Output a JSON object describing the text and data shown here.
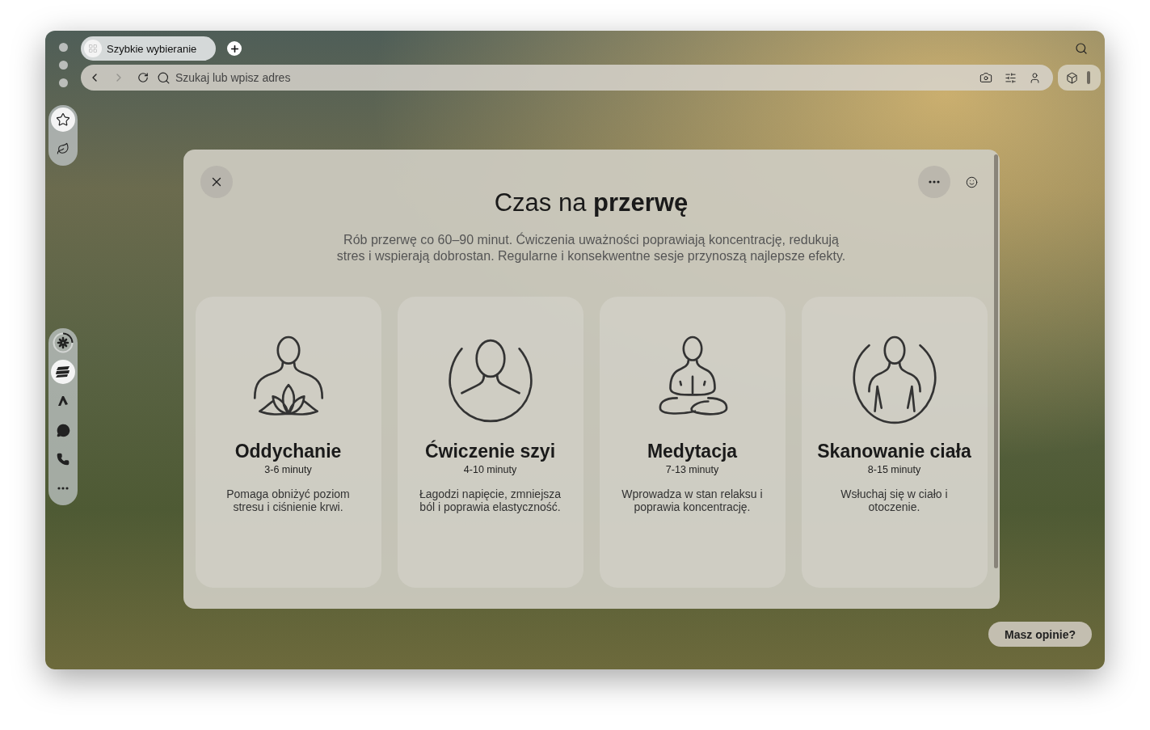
{
  "tabs": [
    {
      "label": "Szybkie wybieranie",
      "selected": true
    }
  ],
  "toolbar": {
    "back": {
      "disabled": false
    },
    "forward": {
      "disabled": true
    },
    "address": {
      "placeholder": "Szukaj lub wpisz adres"
    }
  },
  "sidebar": {
    "top_panel": [
      {
        "kind": "star",
        "selected": true
      },
      {
        "kind": "leaf",
        "selected": false
      }
    ],
    "apps_panel": [
      {
        "kind": "pinwheel",
        "selected": false
      },
      {
        "kind": "stripes",
        "selected": true
      },
      {
        "kind": "peak",
        "selected": false
      },
      {
        "kind": "messenger",
        "selected": false
      },
      {
        "kind": "whatsapp",
        "selected": false
      },
      {
        "kind": "more",
        "selected": false
      }
    ]
  },
  "modal": {
    "title": "Czas na **przerwę**",
    "description": "Rób przerwę co 60–90 minut. Ćwiczenia uważności poprawiają koncentrację, redukują stres i wspierają dobrostan. Regularne i konsekwentne sesje przynoszą najlepsze efekty.",
    "cards": [
      {
        "kind": "lotus",
        "title": "Oddychanie",
        "duration": "3-6 minuty",
        "description": "Pomaga obniżyć poziom stresu i ciśnienie krwi."
      },
      {
        "kind": "neck",
        "title": "Ćwiczenie szyi",
        "duration": "4-10 minuty",
        "description": "Łagodzi napięcie, zmniejsza ból i poprawia elastyczność."
      },
      {
        "kind": "meditation",
        "title": "Medytacja",
        "duration": "7-13 minuty",
        "description": "Wprowadza w stan relaksu i poprawia koncentrację."
      },
      {
        "kind": "body",
        "title": "Skanowanie ciała",
        "duration": "8-15 minuty",
        "description": "Wsłuchaj się w ciało i otoczenie."
      }
    ]
  },
  "feedback_button": "Masz opinie?"
}
